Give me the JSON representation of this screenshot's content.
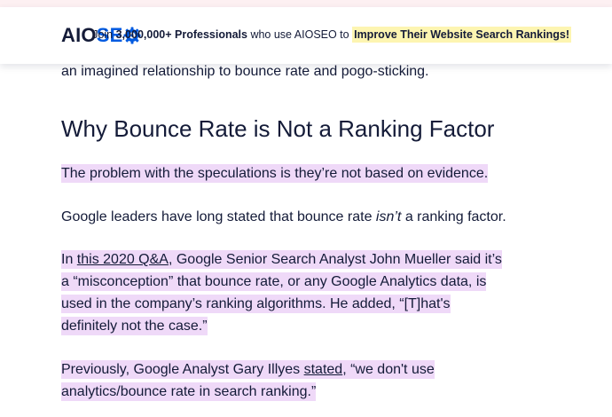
{
  "header": {
    "logo_aio": "AIO",
    "logo_seo": "SE",
    "tagline_prefix": "Join ",
    "tagline_count": "3,000,000+ Professionals",
    "tagline_middle": " who use AIOSEO to ",
    "tagline_highlight": "Improve Their Website Search Rankings!"
  },
  "article": {
    "intro_tail": "an imagined relationship to bounce rate and pogo-sticking.",
    "heading": "Why Bounce Rate is Not a Ranking Factor",
    "p1": "The problem with the speculations is they’re not based on evidence.",
    "p2_before": "Google leaders have long stated that bounce rate ",
    "p2_em": "isn’t",
    "p2_after": " a ranking factor.",
    "p3_line1_before": "In ",
    "p3_link": "this 2020 Q&A",
    "p3_line1_after": ", Google Senior Search Analyst John Mueller said it’s",
    "p3_line2": "a “misconception” that bounce rate, or any Google Analytics data, is",
    "p3_line3": "used in the company’s ranking algorithms. He added, “[T]hat's",
    "p3_line4": "definitely not the case.”",
    "p4_line1_before": "Previously, Google Analyst Gary Illyes ",
    "p4_link": "stated",
    "p4_line1_after": ", “we don't use",
    "p4_line2": "analytics/bounce rate in search ranking.”"
  },
  "colors": {
    "text": "#141b38",
    "brand_blue": "#005ae0",
    "highlight_purple": "#efd9f8",
    "highlight_yellow": "#fdf5b1"
  }
}
